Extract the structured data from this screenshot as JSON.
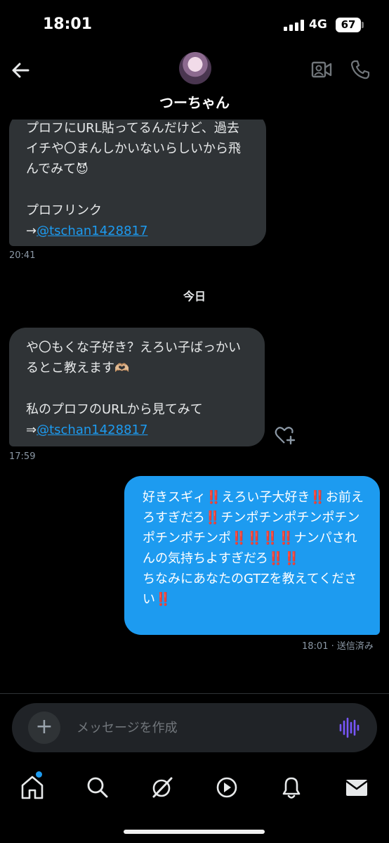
{
  "status_bar": {
    "time": "18:01",
    "network": "4G",
    "battery": "67"
  },
  "header": {
    "contact_name": "つーちゃん",
    "icons": {
      "back": "arrow-left-icon",
      "video": "video-call-icon",
      "phone": "phone-icon"
    }
  },
  "messages": [
    {
      "direction": "incoming",
      "text": "プロフにURL貼ってるんだけど、過去イチや〇まんしかいないらしいから飛んでみて",
      "emoji": "😈",
      "link_label": "プロフリンク",
      "link_prefix": "→",
      "link": "@tschan1428817",
      "time": "20:41"
    },
    {
      "direction": "incoming",
      "text": "や〇もくな子好き？えろい子ばっかいるとこ教えます",
      "emoji": "🫶🏼",
      "line2": "私のプロフのURLから見てみて",
      "link_prefix": "⇒",
      "link": "@tschan1428817",
      "time": "17:59"
    },
    {
      "direction": "outgoing",
      "segments": [
        "好きスギィ",
        "‼️",
        "えろい子大好き",
        "‼️",
        "お前えろすぎだろ",
        "‼️",
        "チンポチンポチンポチンポチンポチンポ",
        "‼️‼️‼️‼️",
        "ナンパされんの気持ちよすぎだろ",
        "‼️‼️",
        "\nちなみにあなたのGTZを教えてください",
        "‼️"
      ],
      "time": "18:01",
      "status": "送信済み"
    }
  ],
  "day_divider": "今日",
  "composer": {
    "placeholder": "メッセージを作成"
  },
  "tabbar": {
    "items": [
      "home-icon",
      "search-icon",
      "grok-icon",
      "video-play-icon",
      "notifications-icon",
      "messages-icon"
    ]
  },
  "colors": {
    "accent": "#1d9bf0",
    "bubble_in": "#2f3336",
    "bubble_out": "#1d9bf0",
    "background": "#000000"
  }
}
